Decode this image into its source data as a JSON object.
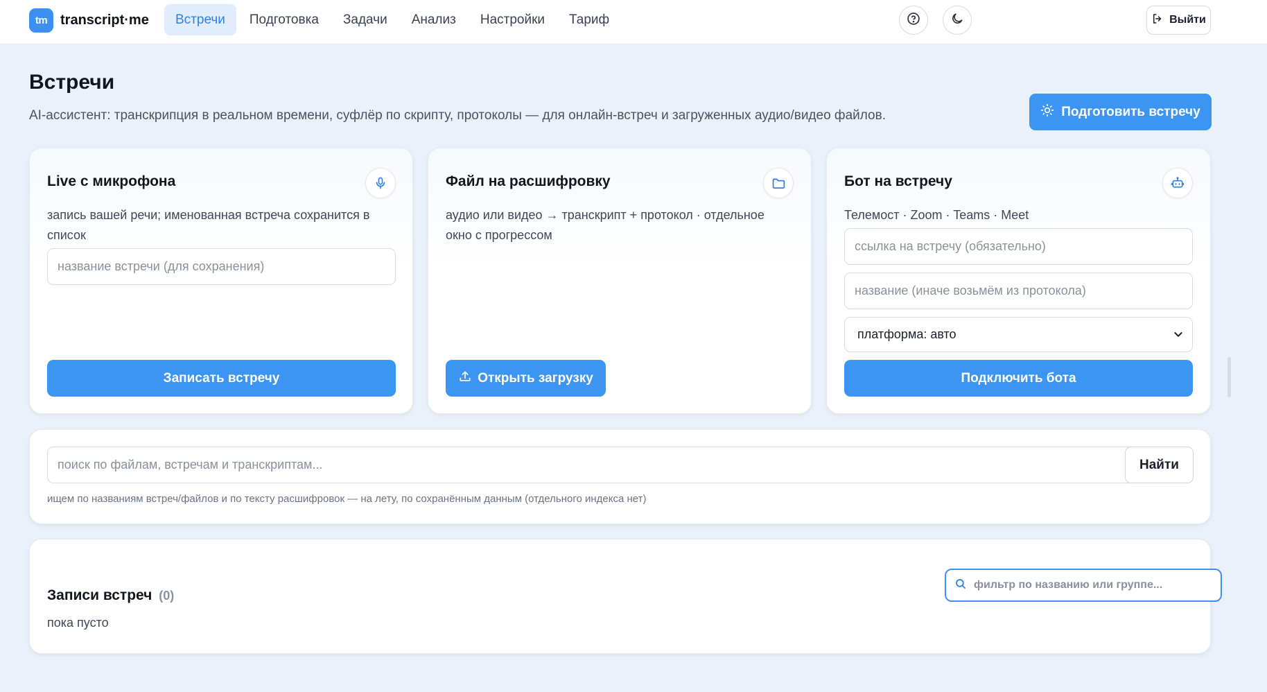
{
  "app": {
    "logo_badge": "tm",
    "name": "transcript·me"
  },
  "nav": {
    "items": [
      {
        "label": "Встречи",
        "active": true
      },
      {
        "label": "Подготовка",
        "active": false
      },
      {
        "label": "Задачи",
        "active": false
      },
      {
        "label": "Анализ",
        "active": false
      },
      {
        "label": "Настройки",
        "active": false
      },
      {
        "label": "Тариф",
        "active": false
      }
    ],
    "logout_label": "Выйти"
  },
  "header": {
    "title": "Встречи",
    "subtitle": "AI-ассистент: транскрипция в реальном времени, суфлёр по скрипту, протоколы — для онлайн-встреч и загруженных аудио/видео файлов.",
    "prepare_label": "Подготовить встречу"
  },
  "cards": {
    "live": {
      "title": "Live с микрофона",
      "desc": "запись вашей речи; именованная встреча сохранится в список",
      "name_placeholder": "название встречи (для сохранения)",
      "button": "Записать встречу"
    },
    "file": {
      "title": "Файл на расшифровку",
      "desc": "аудио или видео → транскрипт + протокол · отдельное окно с прогрессом",
      "button": "Открыть загрузку"
    },
    "bot": {
      "title": "Бот на встречу",
      "desc": "Телемост · Zoom · Teams · Meet",
      "link_placeholder": "ссылка на встречу (обязательно)",
      "name_placeholder": "название (иначе возьмём из протокола)",
      "platform_value": "платформа: авто",
      "button": "Подключить бота"
    }
  },
  "search": {
    "placeholder": "поиск по файлам, встречам и транскриптам...",
    "button": "Найти",
    "hint": "ищем по названиям встреч/файлов и по тексту расшифровок — на лету, по сохранённым данным (отдельного индекса нет)"
  },
  "records": {
    "title": "Записи встреч",
    "count": "(0)",
    "empty": "пока пусто",
    "filter_placeholder": "фильтр по названию или группе..."
  },
  "colors": {
    "accent": "#3d95f2",
    "background": "#eaf1fb",
    "active_nav_bg": "#e1edfb"
  }
}
